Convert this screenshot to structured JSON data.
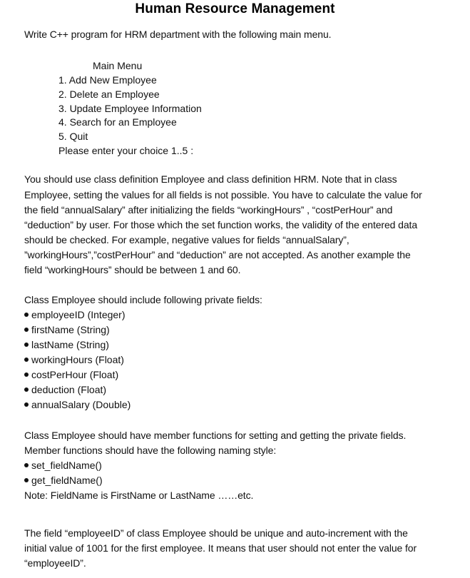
{
  "document": {
    "title": "Human Resource Management",
    "intro": "Write C++ program for HRM department with the following main menu.",
    "menu": {
      "heading": "Main Menu",
      "items": [
        "1. Add New Employee",
        "2. Delete an Employee",
        "3. Update Employee Information",
        "4. Search for an Employee",
        "5. Quit"
      ],
      "prompt": "Please enter your choice 1..5 :"
    },
    "paragraph1": [
      "You should use class definition Employee and class definition HRM. Note that in class",
      "Employee, setting the values for all fields is not possible. You have to calculate the value for",
      "the field “annualSalary” after initializing the fields “workingHours” , “costPerHour” and",
      "“deduction” by user. For those which the set function works, the validity of the entered data",
      "should be checked. For example, negative values for fields “annualSalary”,",
      "”workingHours”,”costPerHour” and “deduction” are not accepted. As another example the",
      "field “workingHours” should be between 1 and 60."
    ],
    "fields_section": {
      "heading": "Class Employee should include following private fields:",
      "fields": [
        "employeeID (Integer)",
        "firstName (String)",
        "lastName (String)",
        "workingHours (Float)",
        "costPerHour (Float)",
        "deduction (Float)",
        "annualSalary (Double)"
      ]
    },
    "functions_section": {
      "lines": [
        "Class Employee should have member functions for setting and getting the private fields.",
        "Member functions should have the following naming style:"
      ],
      "functions": [
        "set_fieldName()",
        "get_fieldName()"
      ],
      "note": "Note: FieldName is FirstName or LastName ……etc."
    },
    "paragraph_last": [
      "The field “employeeID” of class Employee should be unique and auto-increment with the",
      "initial value of 1001 for the first employee. It means that user should not enter the value for",
      "“employeeID”."
    ]
  }
}
